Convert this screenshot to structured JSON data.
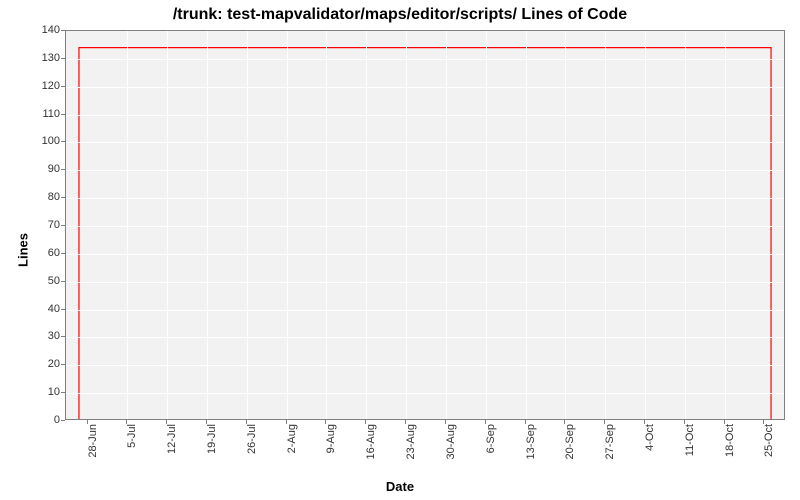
{
  "chart_data": {
    "type": "line",
    "title": "/trunk: test-mapvalidator/maps/editor/scripts/ Lines of Code",
    "xlabel": "Date",
    "ylabel": "Lines",
    "ylim": [
      0,
      140
    ],
    "yticks": [
      0,
      10,
      20,
      30,
      40,
      50,
      60,
      70,
      80,
      90,
      100,
      110,
      120,
      130,
      140
    ],
    "x_categories": [
      "28-Jun",
      "5-Jul",
      "12-Jul",
      "19-Jul",
      "26-Jul",
      "2-Aug",
      "9-Aug",
      "16-Aug",
      "23-Aug",
      "30-Aug",
      "6-Sep",
      "13-Sep",
      "20-Sep",
      "27-Sep",
      "4-Oct",
      "11-Oct",
      "18-Oct",
      "25-Oct"
    ],
    "series": [
      {
        "name": "Lines of Code",
        "color": "#ff0000",
        "points": [
          {
            "x_frac": 0.018,
            "y": 0
          },
          {
            "x_frac": 0.018,
            "y": 134
          },
          {
            "x_frac": 0.982,
            "y": 134
          },
          {
            "x_frac": 0.982,
            "y": 0
          }
        ]
      }
    ]
  }
}
